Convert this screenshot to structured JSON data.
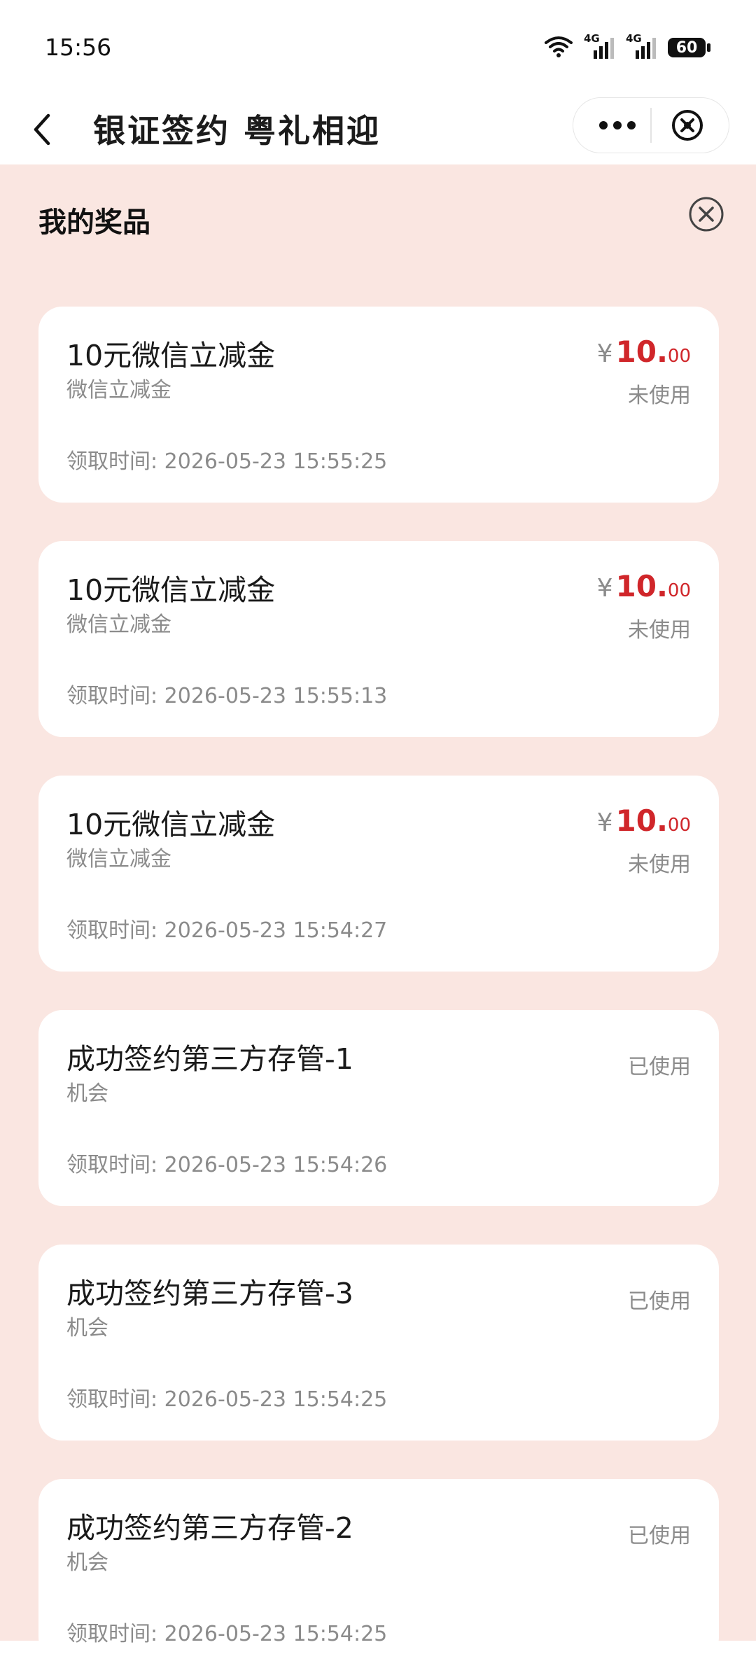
{
  "status_bar": {
    "time": "15:56",
    "battery": "60",
    "network_1": "4G",
    "network_2": "4G"
  },
  "nav": {
    "title": "银证签约 粤礼相迎"
  },
  "panel": {
    "title": "我的奖品"
  },
  "prizes": [
    {
      "name": "10元微信立减金",
      "type": "微信立减金",
      "currency": "¥",
      "amount_int": "10.",
      "amount_dec": "00",
      "status": "未使用",
      "time": "领取时间: 2026-05-23 15:55:25"
    },
    {
      "name": "10元微信立减金",
      "type": "微信立减金",
      "currency": "¥",
      "amount_int": "10.",
      "amount_dec": "00",
      "status": "未使用",
      "time": "领取时间: 2026-05-23 15:55:13"
    },
    {
      "name": "10元微信立减金",
      "type": "微信立减金",
      "currency": "¥",
      "amount_int": "10.",
      "amount_dec": "00",
      "status": "未使用",
      "time": "领取时间: 2026-05-23 15:54:27"
    },
    {
      "name": "成功签约第三方存管-1",
      "type": "机会",
      "status": "已使用",
      "time": "领取时间: 2026-05-23 15:54:26"
    },
    {
      "name": "成功签约第三方存管-3",
      "type": "机会",
      "status": "已使用",
      "time": "领取时间: 2026-05-23 15:54:25"
    },
    {
      "name": "成功签约第三方存管-2",
      "type": "机会",
      "status": "已使用",
      "time": "领取时间: 2026-05-23 15:54:25"
    }
  ],
  "colors": {
    "accent": "#d0262a",
    "background": "#fae6e1",
    "muted": "#8b8b8b"
  },
  "icons": {
    "back": "chevron-left-icon",
    "more": "more-icon",
    "close": "close-circle-icon",
    "wifi": "wifi-icon",
    "signal": "signal-icon"
  }
}
